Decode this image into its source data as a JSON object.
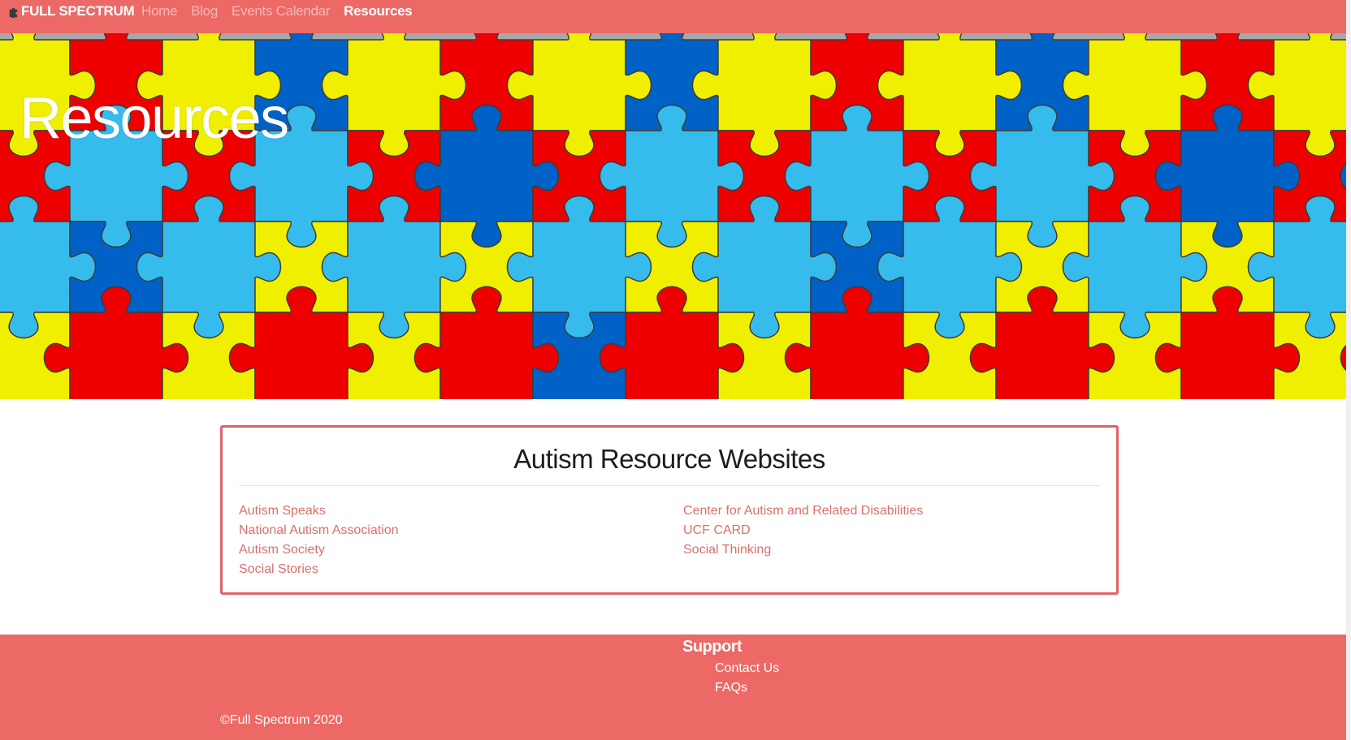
{
  "navbar": {
    "brand_label": "FULL SPECTRUM",
    "brand_icon": "puzzle-piece-icon",
    "links": [
      {
        "label": "Home",
        "active": false
      },
      {
        "label": "Blog",
        "active": false
      },
      {
        "label": "Events Calendar",
        "active": false
      },
      {
        "label": "Resources",
        "active": true
      }
    ]
  },
  "hero": {
    "title": "Resources",
    "background": "puzzle-pattern",
    "puzzle_colors": [
      "#f0ef00",
      "#ee0000",
      "#0062c6",
      "#36bcec"
    ]
  },
  "resources_card": {
    "title": "Autism Resource Websites",
    "left_links": [
      "Autism Speaks",
      "National Autism Association",
      "Autism Society",
      "Social Stories"
    ],
    "right_links": [
      "Center for Autism and Related Disabilities",
      "UCF CARD",
      "Social Thinking"
    ]
  },
  "footer": {
    "support_heading": "Support",
    "support_links": [
      "Contact Us",
      "FAQs"
    ],
    "copyright": "©Full Spectrum 2020"
  },
  "colors": {
    "accent": "#ec6966",
    "link": "#d9706c",
    "card_border": "#e3626a"
  }
}
